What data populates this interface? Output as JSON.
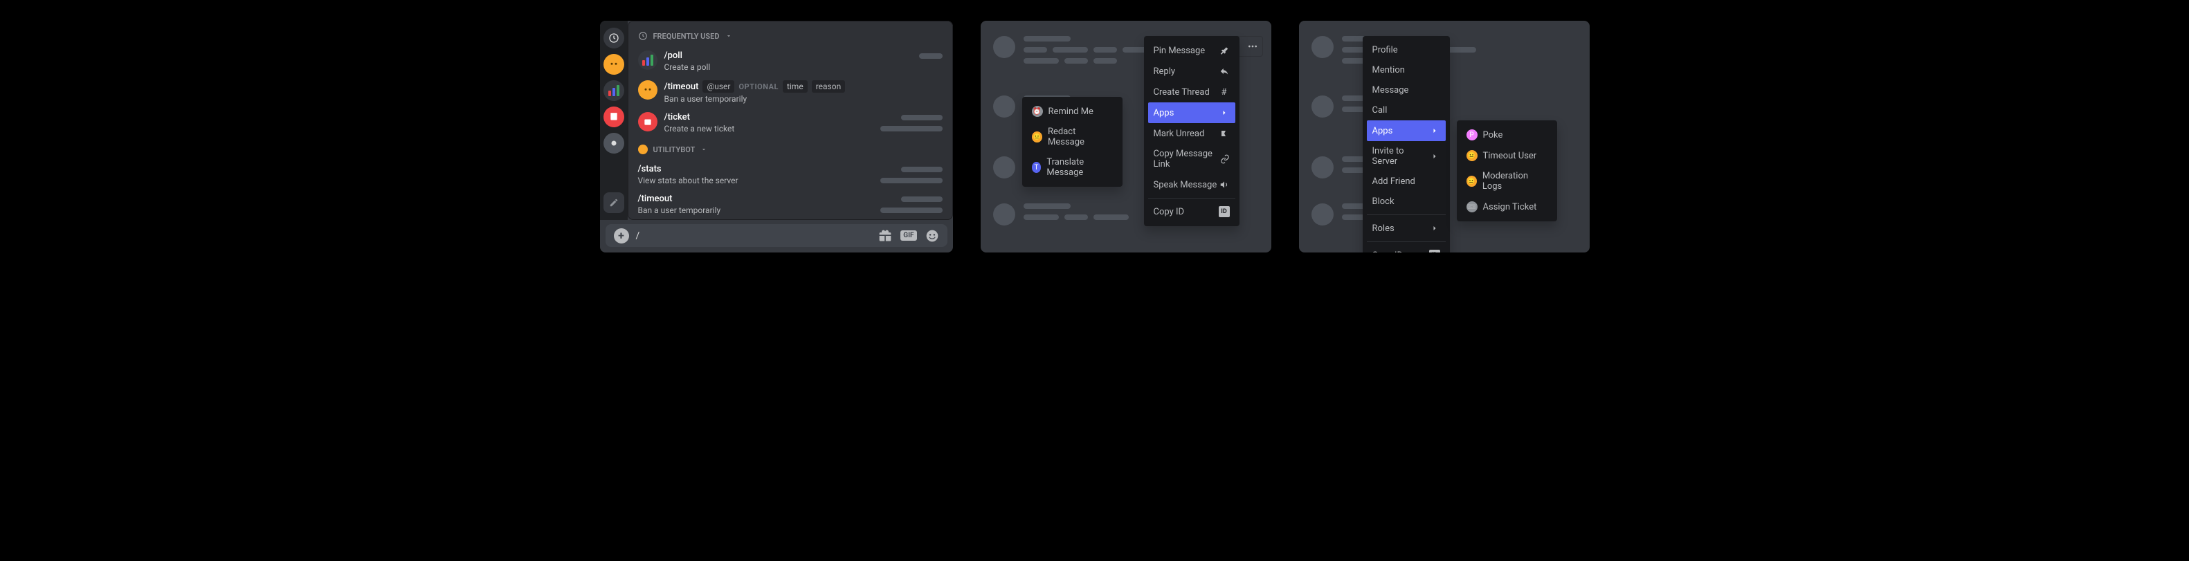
{
  "panel1": {
    "sections": {
      "frequently_used": "Frequently Used",
      "utilitybot": "UtilityBot"
    },
    "commands": {
      "poll": {
        "name": "/poll",
        "desc": "Create a poll"
      },
      "timeout": {
        "name": "/timeout",
        "param_user": "@user",
        "optional_label": "OPTIONAL",
        "param_time": "time",
        "param_reason": "reason",
        "desc": "Ban a user temporarily"
      },
      "ticket": {
        "name": "/ticket",
        "desc": "Create a new ticket"
      },
      "stats": {
        "name": "/stats",
        "desc": "View stats about the server"
      },
      "timeout2": {
        "name": "/timeout",
        "desc": "Ban a user temporarily"
      }
    },
    "input_value": "/"
  },
  "panel2": {
    "submenu": {
      "remind_me": "Remind Me",
      "redact": "Redact Message",
      "translate": "Translate Message"
    },
    "menu": {
      "pin": "Pin Message",
      "reply": "Reply",
      "create_thread": "Create Thread",
      "apps": "Apps",
      "mark_unread": "Mark Unread",
      "copy_link": "Copy Message Link",
      "speak": "Speak Message",
      "copy_id": "Copy ID"
    }
  },
  "panel3": {
    "menu": {
      "profile": "Profile",
      "mention": "Mention",
      "message": "Message",
      "call": "Call",
      "apps": "Apps",
      "invite": "Invite to Server",
      "add_friend": "Add Friend",
      "block": "Block",
      "roles": "Roles",
      "copy_id": "Copy ID"
    },
    "submenu": {
      "poke": "Poke",
      "timeout_user": "Timeout User",
      "moderation_logs": "Moderation Logs",
      "assign_ticket": "Assign Ticket"
    }
  }
}
